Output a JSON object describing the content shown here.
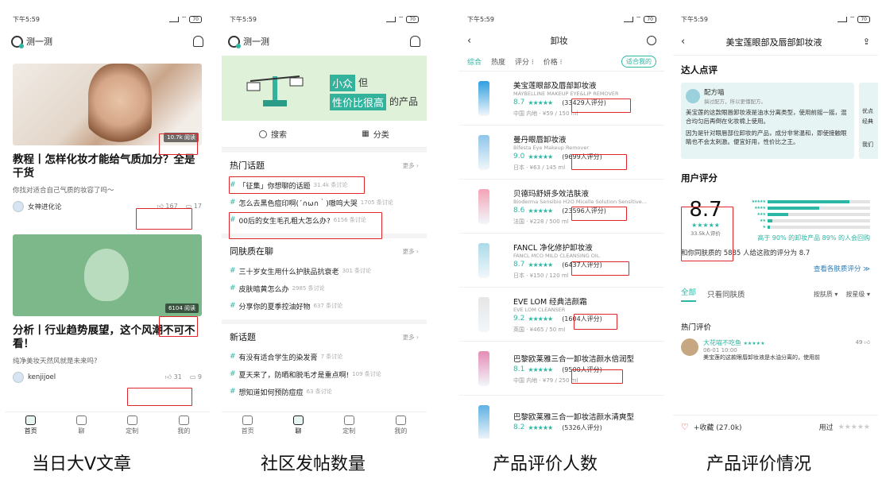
{
  "status": {
    "time": "下午5:59",
    "battery": "70"
  },
  "p1": {
    "app_name": "测一测",
    "articles": [
      {
        "badge": "10.7k 阅读",
        "title": "教程丨怎样化妆才能给气质加分？全是干货",
        "subtitle": "你找对适合自己气质的妆容了吗～",
        "author": "女神进化论",
        "likes": "167",
        "comments": "17"
      },
      {
        "badge": "6104 阅读",
        "title": "分析丨行业趋势展望，这个风潮不可不看！",
        "subtitle": "纯净美妆天然风就是未来吗?",
        "author": "kenjijoel",
        "likes": "31",
        "comments": "9"
      }
    ],
    "tabs": [
      "首页",
      "聊",
      "定制",
      "我的"
    ]
  },
  "p2": {
    "app_name": "测一测",
    "banner": {
      "tag1": "小众",
      "t1": "但",
      "tag2": "性价比很高",
      "t2": "的产品"
    },
    "search": "搜索",
    "category": "分类",
    "more": "更多",
    "sections": [
      {
        "title": "热门话题",
        "topics": [
          {
            "text": "「征集」你想聊的话题",
            "count": "31.4k 条讨论"
          },
          {
            "text": "怎么去黑色痘印啊(´∩ω∩｀)嗷呜大哭",
            "count": "1705 条讨论"
          },
          {
            "text": "00后的女生毛孔粗大怎么办?",
            "count": "6156 条讨论"
          }
        ]
      },
      {
        "title": "同肤质在聊",
        "topics": [
          {
            "text": "三十岁女生用什么护肤品抗衰老",
            "count": "301 条讨论"
          },
          {
            "text": "皮肤暗黄怎么办",
            "count": "2985 条讨论"
          },
          {
            "text": "分享你的夏季控油好物",
            "count": "637 条讨论"
          }
        ]
      },
      {
        "title": "新话题",
        "topics": [
          {
            "text": "有没有适合学生的染发膏",
            "count": "7 条讨论"
          },
          {
            "text": "夏天来了，防晒和脱毛才是重点啊!",
            "count": "109 条讨论"
          },
          {
            "text": "想知道如何预防痘痘",
            "count": "63 条讨论"
          }
        ]
      }
    ],
    "tabs": [
      "首页",
      "聊",
      "定制",
      "我的"
    ]
  },
  "p3": {
    "title": "卸妆",
    "filters": [
      "综合",
      "热度",
      "评分",
      "价格"
    ],
    "pill": "适合我的",
    "products": [
      {
        "name": "美宝莲眼部及唇部卸妆液",
        "en": "MAYBELLINE MAKEUP EYE&LIP REMOVER",
        "score": "8.7",
        "count": "(33429人评分)",
        "origin": "中国 内地 · ¥59 / 150 ml",
        "color": "#2f9fe0"
      },
      {
        "name": "曼丹眼唇卸妆液",
        "en": "Bifesta Eye Makeup Remover",
        "score": "9.0",
        "count": "(9699人评分)",
        "origin": "日本 · ¥63 / 145 ml",
        "color": "#8ec6ea"
      },
      {
        "name": "贝德玛舒妍多效洁肤液",
        "en": "Bioderma Sensibio H2O Micelle Solution Sensitive...",
        "score": "8.6",
        "count": "(23596人评分)",
        "origin": "法国 · ¥228 / 500 ml",
        "color": "#f4a3b6"
      },
      {
        "name": "FANCL 净化修护卸妆液",
        "en": "FANCL MCO MILD CLEANSING OIL",
        "score": "8.7",
        "count": "(6437人评分)",
        "origin": "日本 · ¥150 / 120 ml",
        "color": "#a9dbe8"
      },
      {
        "name": "EVE LOM 经典洁颜霜",
        "en": "EVE LOM CLEANSER",
        "score": "9.2",
        "count": "(1604人评分)",
        "origin": "英国 · ¥465 / 50 ml",
        "color": "#e6e6e6"
      },
      {
        "name": "巴黎欧莱雅三合一卸妆洁颜水倍润型",
        "en": "",
        "score": "8.1",
        "count": "(9500人评分)",
        "origin": "中国 内地 · ¥79 / 250 ml",
        "color": "#e58cb5"
      },
      {
        "name": "巴黎欧莱雅三合一卸妆洁颜水清爽型",
        "en": "",
        "score": "8.2",
        "count": "(5326人评分)",
        "origin": "",
        "color": "#5fb1e3"
      }
    ]
  },
  "p4": {
    "title": "美宝莲眼部及唇部卸妆液",
    "expert_title": "达人点评",
    "review": {
      "name": "配方喵",
      "sub": "搞过配方，所以更懂配方。",
      "text1": "美宝莲的这款眼唇卸妆液是油水分离类型，使用前摇一摇，混合均匀后再倒在化妆棉上使用。",
      "text2": "因为是针对眼唇部位卸妆的产品，成分非常温和，即使接触眼睛也不会太刺激。便宜好用，性价比之王。"
    },
    "peek": {
      "a": "优点",
      "b": "经典",
      "c": "我们"
    },
    "user_title": "用户评分",
    "score": "8.7",
    "score_count": "33.5k人评价",
    "bars": [
      0.8,
      0.5,
      0.2,
      0.05,
      0.02
    ],
    "pct": "高于 90% 的卸妆产品  89% 的人会回购",
    "same_skin": "和你同肤质的 5885 人给这款的评分为 8.7",
    "link": "查看各肤质评分 ≫",
    "tabs": [
      "全部",
      "只看同肤质",
      "按肤质",
      "按星级"
    ],
    "hot_title": "热门评价",
    "hot": {
      "name": "大花喵不吃鱼",
      "date": "06-01 10:00",
      "likes": "49",
      "snippet": "美宝莲的这款眼唇卸妆液是水油分离的，使用前"
    },
    "fav": "+收藏 (27.0k)",
    "used": "用过"
  },
  "captions": [
    "当日大V文章",
    "社区发帖数量",
    "产品评价人数",
    "产品评价情况"
  ],
  "colors": {
    "accent": "#2bb7a3",
    "highlight": "#e0262d"
  }
}
